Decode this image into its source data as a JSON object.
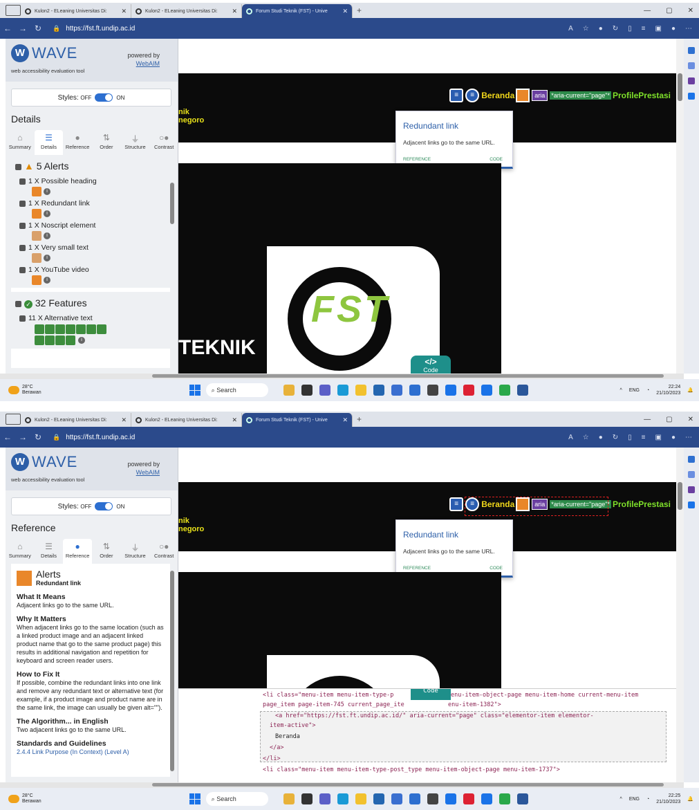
{
  "browser": {
    "tabs": [
      "Kulon2 - ELeaning Universitas Di:",
      "Kulon2 - ELeaning Universitas Di:",
      "Forum Studi Teknik (FST) - Unive"
    ],
    "url": "https://fst.ft.undip.ac.id"
  },
  "wave": {
    "logo_text": "WAVE",
    "tagline": "web accessibility evaluation tool",
    "powered_by": "powered by",
    "webaim": "WebAIM",
    "styles_label": "Styles:",
    "off": "OFF",
    "on": "ON",
    "tabs": [
      "Summary",
      "Details",
      "Reference",
      "Order",
      "Structure",
      "Contrast"
    ]
  },
  "shot1": {
    "section": "Details",
    "alerts_heading": "5 Alerts",
    "alerts": [
      "1 X Possible heading",
      "1 X Redundant link",
      "1 X Noscript element",
      "1 X Very small text",
      "1 X YouTube video"
    ],
    "features_heading": "32 Features",
    "features": [
      "11 X Alternative text"
    ]
  },
  "shot2": {
    "section": "Reference",
    "ref_title": "Alerts",
    "ref_sub": "Redundant link",
    "what_h": "What It Means",
    "what_t": "Adjacent links go to the same URL.",
    "why_h": "Why It Matters",
    "why_t": "When adjacent links go to the same location (such as a linked product image and an adjacent linked product name that go to the same product page) this results in additional navigation and repetition for keyboard and screen reader users.",
    "fix_h": "How to Fix It",
    "fix_t": "If possible, combine the redundant links into one link and remove any redundant text or alternative text (for example, if a product image and product name are in the same link, the image can usually be given alt=\"\").",
    "algo_h": "The Algorithm... in English",
    "algo_t": "Two adjacent links go to the same URL.",
    "std_h": "Standards and Guidelines",
    "std_t": "2.4.4 Link Purpose (In Context) (Level A)",
    "code_lines": [
      "<li class=\"menu-item menu-item-type-p",
      "enu-item-object-page menu-item-home current-menu-item",
      "page_item page-item-745 current_page_ite",
      "enu-item-1382\">",
      "<a href=\"https://fst.ft.undip.ac.id/\" aria-current=\"page\" class=\"elementor-item elementor-",
      "item-active\">",
      "Beranda",
      "</a>",
      "</li>",
      "<li class=\"menu-item menu-item-type-post_type menu-item-object-page menu-item-1737\">"
    ]
  },
  "page": {
    "beranda": "Beranda",
    "aria": "aria",
    "aria_current": "*aria-current=\"page\"*",
    "profile": "ProfilePrestasi",
    "nik": "nik",
    "negoro": "negoro",
    "teknik": "TEKNIK",
    "fst": "FST",
    "code_btn": "</>",
    "code_lbl": "Code",
    "tip_title": "Redundant link",
    "tip_desc": "Adjacent links go to the same URL.",
    "tip_ref": "REFERENCE",
    "tip_code": "CODE"
  },
  "taskbar": {
    "temp": "28°C",
    "weather": "Berawan",
    "search": "Search",
    "lang": "ENG",
    "time1": "22:24",
    "time2": "22:25",
    "date": "21/10/2023"
  }
}
